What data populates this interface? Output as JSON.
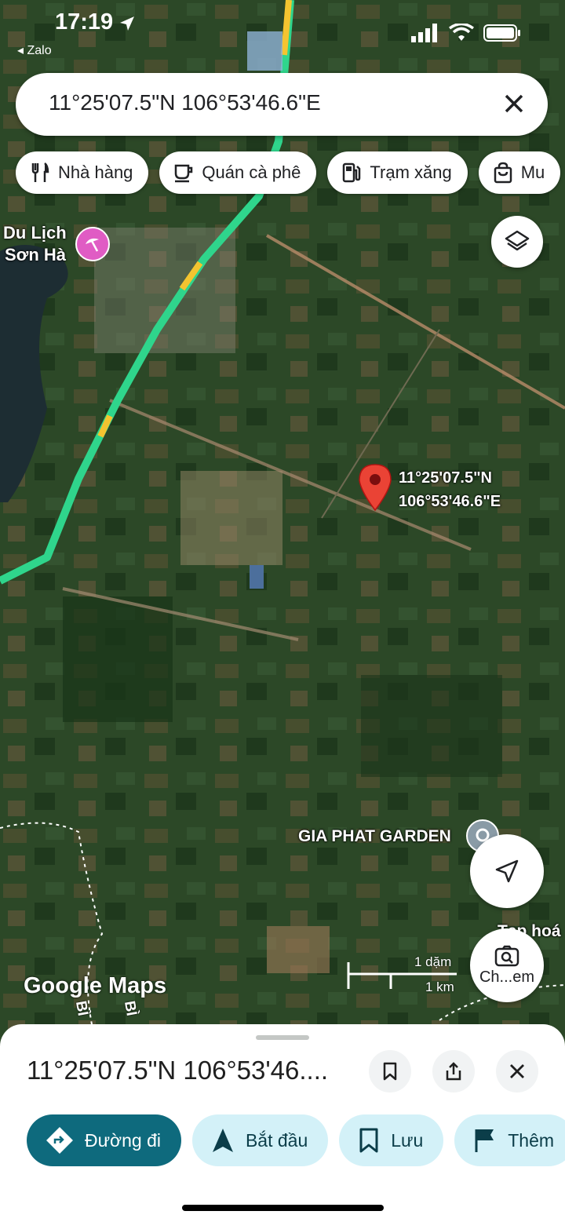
{
  "status": {
    "time": "17:19",
    "back_app": "Zalo"
  },
  "search": {
    "query": "11°25'07.5\"N 106°53'46.6\"E"
  },
  "chips": [
    {
      "icon": "restaurant-icon",
      "label": "Nhà hàng"
    },
    {
      "icon": "coffee-icon",
      "label": "Quán cà phê"
    },
    {
      "icon": "gas-station-icon",
      "label": "Trạm xăng"
    },
    {
      "icon": "shopping-bag-icon",
      "label": "Mu"
    }
  ],
  "map": {
    "pin": {
      "lat_label": "11°25'07.5\"N",
      "lng_label": "106°53'46.6\"E"
    },
    "places": {
      "resort_line1": "Du Lịch",
      "resort_line2": "Sơn Hà",
      "garden": "GIA PHAT GARDEN",
      "shop": "Tạp hoá",
      "road_labels": [
        "BÌ",
        "BÌ"
      ]
    },
    "scale": {
      "imperial": "1 dặm",
      "metric": "1 km"
    },
    "watermark": "Google Maps",
    "camera_label": "Ch...em"
  },
  "sheet": {
    "title": "11°25'07.5\"N 106°53'46....",
    "actions": [
      {
        "icon": "directions-icon",
        "label": "Đường đi"
      },
      {
        "icon": "navigation-arrow-icon",
        "label": "Bắt đầu"
      },
      {
        "icon": "bookmark-icon",
        "label": "Lưu"
      },
      {
        "icon": "flag-icon",
        "label": "Thêm"
      }
    ]
  },
  "colors": {
    "accent": "#0e6a7d",
    "action_bg": "#d3f1f8",
    "pin_red": "#ea4335",
    "route_green": "#2fd58c",
    "route_yellow": "#f4c430",
    "resort_pink": "#e05cc4"
  }
}
